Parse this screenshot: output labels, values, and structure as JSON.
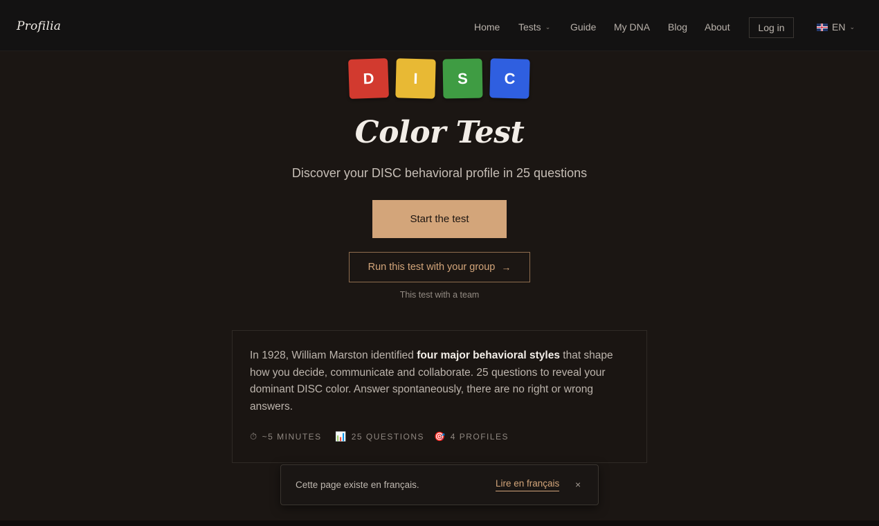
{
  "nav": {
    "logo": "Profilia",
    "items": [
      {
        "label": "Home"
      },
      {
        "label": "Tests",
        "has_dropdown": true
      },
      {
        "label": "Guide"
      },
      {
        "label": "My DNA"
      },
      {
        "label": "Blog"
      },
      {
        "label": "About"
      }
    ],
    "login_label": "Log in",
    "language": {
      "flag": "uk-flag-icon",
      "label": "EN"
    }
  },
  "hero": {
    "tiles": [
      {
        "letter": "D",
        "color": "#d23a2f"
      },
      {
        "letter": "I",
        "color": "#e8b934"
      },
      {
        "letter": "S",
        "color": "#3f9c43"
      },
      {
        "letter": "C",
        "color": "#2f5fe0"
      }
    ],
    "title": "Color Test",
    "subtitle": "Discover your DISC behavioral profile in 25 questions",
    "start_label": "Start the test",
    "group_label": "Run this test with your group",
    "group_arrow": "→",
    "team_note": "This test with a team"
  },
  "card": {
    "text_before": "In 1928, William Marston identified ",
    "text_bold": "four major behavioral styles",
    "text_after": " that shape how you decide, communicate and collaborate. 25 questions to reveal your dominant DISC color. Answer spontaneously, there are no right or wrong answers.",
    "meta": [
      {
        "icon": "stopwatch-icon",
        "glyph": "⏱",
        "label": "~5 MINUTES"
      },
      {
        "icon": "bar-chart-icon",
        "glyph": "📊",
        "label": "25 QUESTIONS"
      },
      {
        "icon": "target-icon",
        "glyph": "🎯",
        "label": "4 PROFILES"
      }
    ]
  },
  "toast": {
    "text": "Cette page existe en français.",
    "link_label": "Lire en français",
    "close_glyph": "×"
  },
  "colors": {
    "background": "#1b1613",
    "accent": "#d3a57a",
    "nav_background": "#131212"
  }
}
